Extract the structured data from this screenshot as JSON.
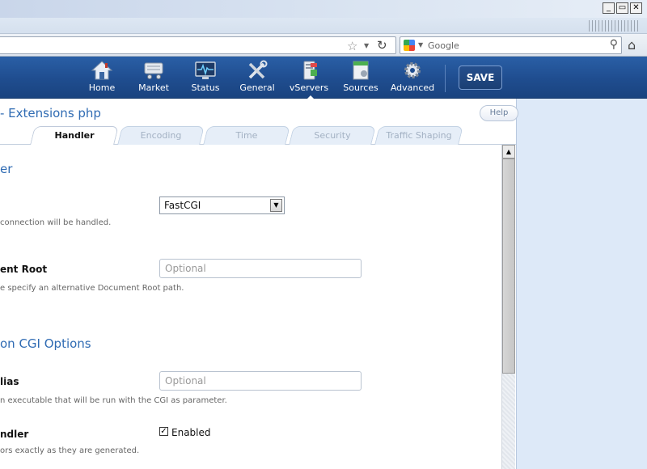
{
  "window": {
    "controls": [
      "_",
      "▭",
      "✕"
    ]
  },
  "browser": {
    "search_placeholder": "Google"
  },
  "nav": {
    "items": [
      {
        "label": "Home",
        "icon": "home-icon"
      },
      {
        "label": "Market",
        "icon": "market-cart-icon"
      },
      {
        "label": "Status",
        "icon": "status-monitor-icon"
      },
      {
        "label": "General",
        "icon": "tools-icon"
      },
      {
        "label": "vServers",
        "icon": "vservers-icon"
      },
      {
        "label": "Sources",
        "icon": "sources-icon"
      },
      {
        "label": "Advanced",
        "icon": "gear-icon"
      }
    ],
    "active": "vServers",
    "save_label": "SAVE"
  },
  "page": {
    "title": "- Extensions php",
    "help_label": "Help"
  },
  "tabs": [
    {
      "label": "Handler",
      "active": true
    },
    {
      "label": "Encoding",
      "active": false
    },
    {
      "label": "Time",
      "active": false
    },
    {
      "label": "Security",
      "active": false
    },
    {
      "label": "Traffic Shaping",
      "active": false
    }
  ],
  "content": {
    "section1_title": "er",
    "handler_help": "connection will be handled.",
    "handler_value": "FastCGI",
    "docroot_label": "ent Root",
    "docroot_placeholder": "Optional",
    "docroot_help": "e specify an alternative Document Root path.",
    "section2_title": "on CGI Options",
    "alias_label": "lias",
    "alias_placeholder": "Optional",
    "alias_help": "n executable that will be run with the CGI as parameter.",
    "errors_label": "ndler",
    "errors_help": "ors exactly as they are generated.",
    "errors_checkbox_label": "Enabled",
    "errors_checked": true
  },
  "colors": {
    "header_blue": "#1f4d8f",
    "accent_text": "#2f6bb3",
    "right_pane": "#dde9f8"
  }
}
